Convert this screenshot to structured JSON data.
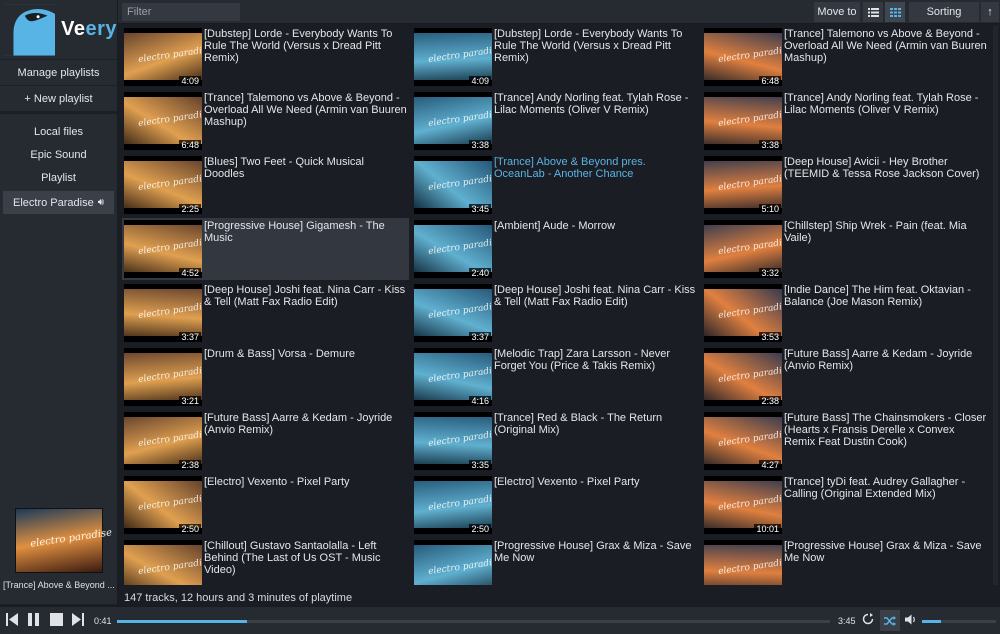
{
  "app": {
    "brand_part1": "Ve",
    "brand_part2": "ery",
    "accent_color": "#59b4e6"
  },
  "sidebar": {
    "manage_playlists": "Manage playlists",
    "new_playlist": "+ New playlist",
    "items": [
      {
        "label": "Local files",
        "active": false
      },
      {
        "label": "Epic Sound",
        "active": false
      },
      {
        "label": "Playlist",
        "active": false
      },
      {
        "label": "Electro Paradise",
        "active": true,
        "icon": "speaker-icon"
      }
    ]
  },
  "toolbar": {
    "filter_placeholder": "Filter",
    "move_to_label": "Move to",
    "list_view_icon": "list-view-icon",
    "grid_view_icon": "grid-view-icon",
    "sorting_label": "Sorting",
    "sort_direction_icon": "arrow-up-icon"
  },
  "tracks": [
    {
      "title": "[Dubstep] Lorde - Everybody Wants To Rule The World (Versus x Dread Pitt Remix)",
      "duration": "4:09"
    },
    {
      "title": "[Dubstep] Lorde - Everybody Wants To Rule The World (Versus x Dread Pitt Remix)",
      "duration": "4:09"
    },
    {
      "title": "[Trance] Talemono vs Above & Beyond - Overload All We Need (Armin van Buuren Mashup)",
      "duration": "6:48"
    },
    {
      "title": "[Trance] Talemono vs Above & Beyond - Overload All We Need (Armin van Buuren Mashup)",
      "duration": "6:48"
    },
    {
      "title": "[Trance] Andy Norling feat. Tylah Rose - Lilac Moments (Oliver V Remix)",
      "duration": "3:38"
    },
    {
      "title": "[Trance] Andy Norling feat. Tylah Rose - Lilac Moments (Oliver V Remix)",
      "duration": "3:38"
    },
    {
      "title": "[Blues] Two Feet - Quick Musical Doodles",
      "duration": "2:25"
    },
    {
      "title": "[Trance] Above & Beyond pres. OceanLab - Another Chance",
      "duration": "3:45",
      "playing": true
    },
    {
      "title": "[Deep House] Avicii - Hey Brother (TEEMID & Tessa Rose Jackson Cover)",
      "duration": "5:10"
    },
    {
      "title": "[Progressive House] Gigamesh - The Music",
      "duration": "4:52",
      "highlighted": true
    },
    {
      "title": "[Ambient] Aude - Morrow",
      "duration": "2:40"
    },
    {
      "title": "[Chillstep] Ship Wrek - Pain (feat. Mia Vaile)",
      "duration": "3:32"
    },
    {
      "title": "[Deep House] Joshi feat. Nina Carr - Kiss & Tell (Matt Fax Radio Edit)",
      "duration": "3:37"
    },
    {
      "title": "[Deep House] Joshi feat. Nina Carr - Kiss & Tell (Matt Fax Radio Edit)",
      "duration": "3:37"
    },
    {
      "title": "[Indie Dance] The Him feat. Oktavian - Balance (Joe Mason Remix)",
      "duration": "3:53"
    },
    {
      "title": "[Drum & Bass] Vorsa - Demure",
      "duration": "3:21"
    },
    {
      "title": "[Melodic Trap] Zara Larsson - Never Forget You (Price & Takis Remix)",
      "duration": "4:16"
    },
    {
      "title": "[Future Bass] Aarre & Kedam - Joyride (Anvio Remix)",
      "duration": "2:38"
    },
    {
      "title": "[Future Bass] Aarre & Kedam - Joyride (Anvio Remix)",
      "duration": "2:38"
    },
    {
      "title": "[Trance] Red & Black - The Return (Original Mix)",
      "duration": "3:35"
    },
    {
      "title": "[Future Bass] The Chainsmokers - Closer (Hearts x Fransis Derelle x Convex Remix Feat Dustin Cook)",
      "duration": "4:27"
    },
    {
      "title": "[Electro] Vexento - Pixel Party",
      "duration": "2:50"
    },
    {
      "title": "[Electro] Vexento - Pixel Party",
      "duration": "2:50"
    },
    {
      "title": "[Trance] tyDi feat. Audrey Gallagher - Calling (Original Extended Mix)",
      "duration": "10:01"
    },
    {
      "title": "[Chillout] Gustavo Santaolalla - Left Behind (The Last of Us OST - Music Video)",
      "duration": ""
    },
    {
      "title": "[Progressive House] Grax & Miza - Save Me Now",
      "duration": ""
    },
    {
      "title": "[Progressive House] Grax & Miza - Save Me Now",
      "duration": ""
    }
  ],
  "thumbnail_watermark": "electro paradise",
  "status": {
    "summary": "147 tracks, 12 hours and 3 minutes of playtime"
  },
  "now_playing": {
    "title": "[Trance] Above & Beyond ..."
  },
  "player": {
    "elapsed": "0:41",
    "total": "3:45",
    "progress_fraction": 0.182,
    "volume_fraction": 0.25,
    "repeat_icon": "repeat-icon",
    "shuffle_icon": "shuffle-icon",
    "volume_icon": "volume-icon"
  }
}
